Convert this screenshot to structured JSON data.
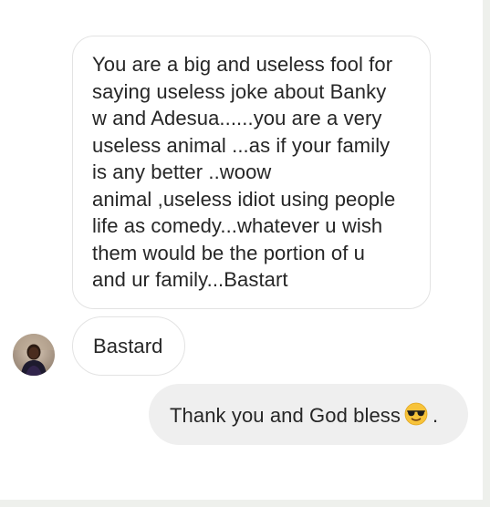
{
  "conversation": {
    "incoming": [
      {
        "lines": [
          "You are a big and useless fool for",
          "saying useless joke about Banky",
          "w and Adesua......you are a very",
          "useless animal ...as if your family",
          "is any better ..woow",
          "animal ,useless idiot using people",
          "life as comedy...whatever u wish",
          "them would be the portion of u",
          "and ur family...Bastart"
        ]
      },
      {
        "text": "Bastard"
      }
    ],
    "outgoing": [
      {
        "text_before_emoji": "Thank you and God bless",
        "emoji": "smiling-face-with-sunglasses-icon",
        "text_after_emoji": "."
      }
    ]
  },
  "colors": {
    "incoming_bubble_bg": "#ffffff",
    "incoming_bubble_border": "#e3e3e3",
    "outgoing_bubble_bg": "#efefef",
    "text": "#262626",
    "background": "#ffffff"
  }
}
